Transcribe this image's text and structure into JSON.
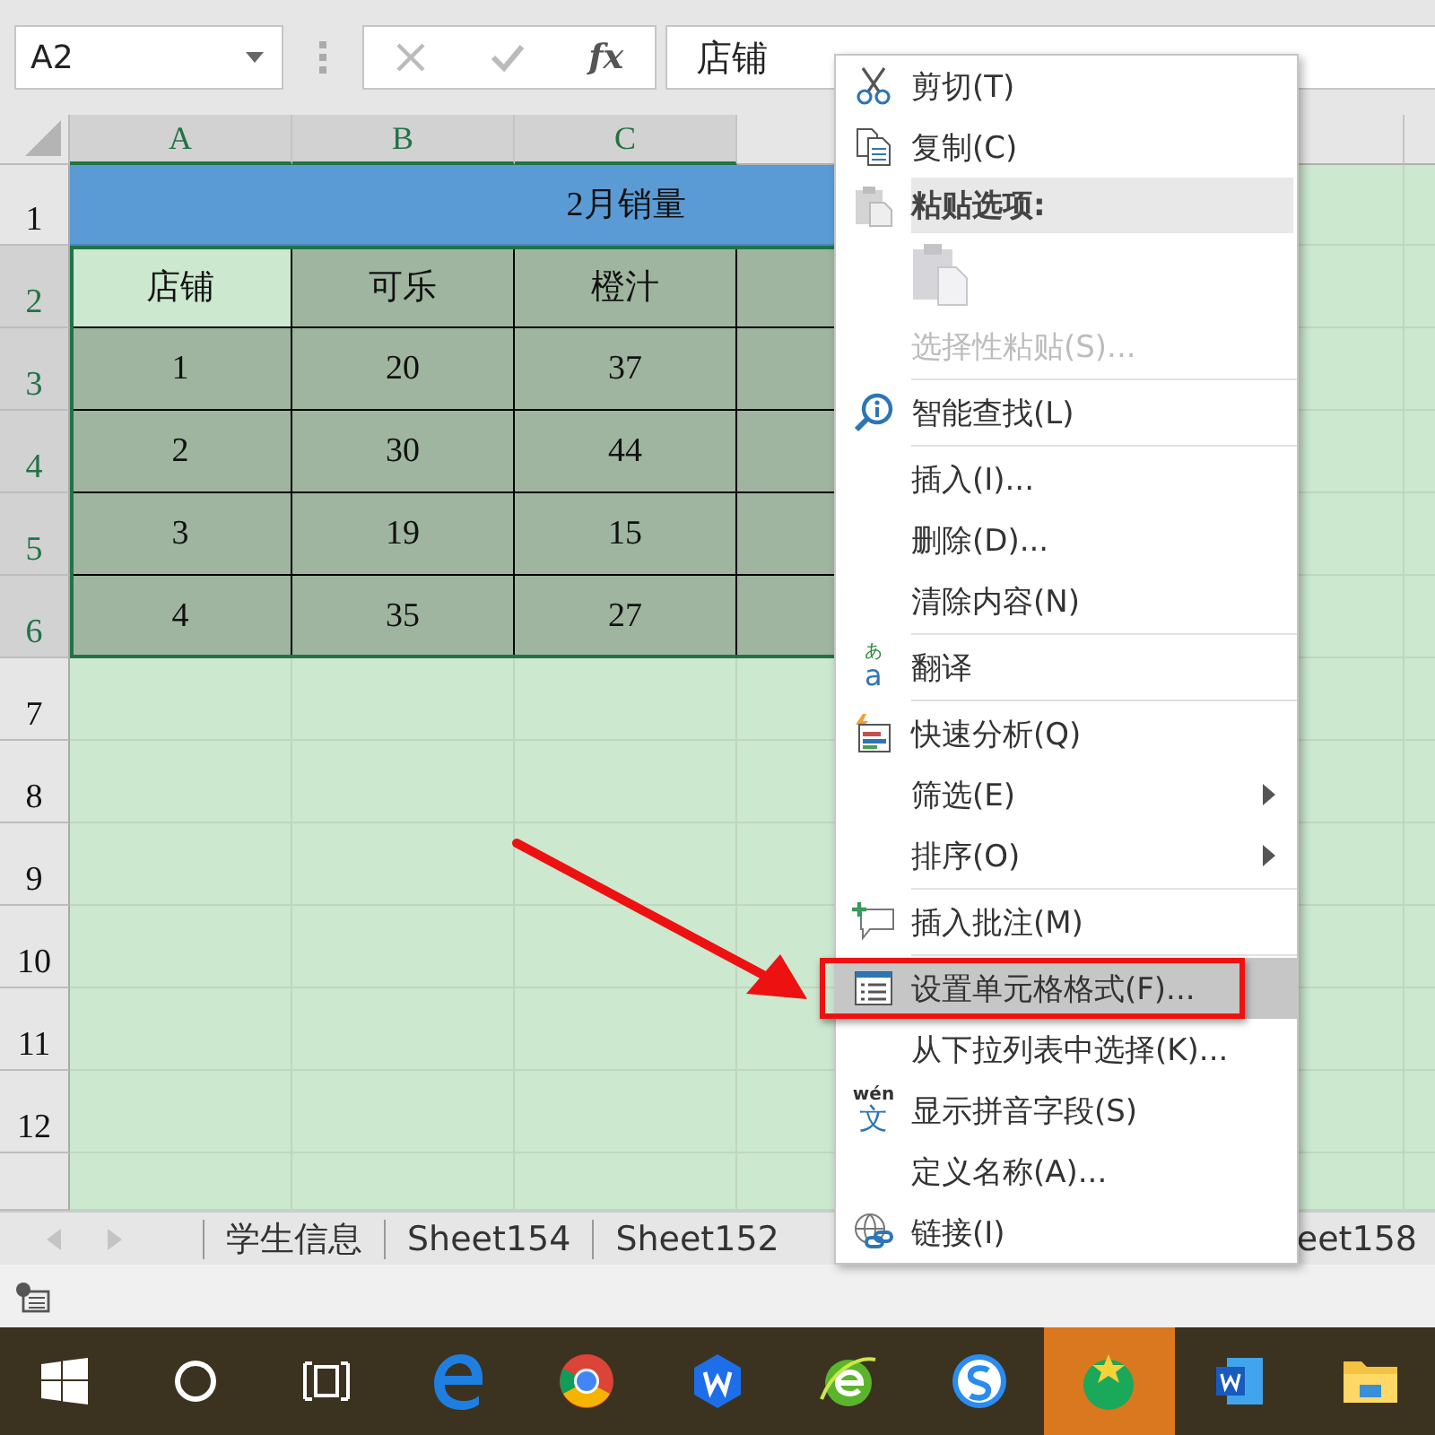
{
  "name_box": {
    "value": "A2"
  },
  "formula_bar": {
    "function_label": "fx",
    "value": "店铺"
  },
  "sheet": {
    "columns": [
      {
        "label": "A",
        "selected": true
      },
      {
        "label": "B",
        "selected": true
      },
      {
        "label": "C",
        "selected": true
      }
    ],
    "rows": [
      {
        "label": "1",
        "selected": false,
        "kind": "title",
        "text": "2月销量"
      },
      {
        "label": "2",
        "selected": true,
        "kind": "table",
        "cells": [
          {
            "text": "店铺",
            "active": true
          },
          {
            "text": "可乐",
            "active": false
          },
          {
            "text": "橙汁",
            "active": false
          }
        ]
      },
      {
        "label": "3",
        "selected": true,
        "kind": "table",
        "cells": [
          {
            "text": "1",
            "active": false
          },
          {
            "text": "20",
            "active": false
          },
          {
            "text": "37",
            "active": false
          }
        ]
      },
      {
        "label": "4",
        "selected": true,
        "kind": "table",
        "cells": [
          {
            "text": "2",
            "active": false
          },
          {
            "text": "30",
            "active": false
          },
          {
            "text": "44",
            "active": false
          }
        ]
      },
      {
        "label": "5",
        "selected": true,
        "kind": "table",
        "cells": [
          {
            "text": "3",
            "active": false
          },
          {
            "text": "19",
            "active": false
          },
          {
            "text": "15",
            "active": false
          }
        ]
      },
      {
        "label": "6",
        "selected": true,
        "kind": "table",
        "cells": [
          {
            "text": "4",
            "active": false
          },
          {
            "text": "35",
            "active": false
          },
          {
            "text": "27",
            "active": false
          }
        ]
      },
      {
        "label": "7",
        "selected": false,
        "kind": "blank"
      },
      {
        "label": "8",
        "selected": false,
        "kind": "blank"
      },
      {
        "label": "9",
        "selected": false,
        "kind": "blank"
      },
      {
        "label": "10",
        "selected": false,
        "kind": "blank"
      },
      {
        "label": "11",
        "selected": false,
        "kind": "blank"
      },
      {
        "label": "12",
        "selected": false,
        "kind": "blank"
      }
    ]
  },
  "sheet_tabs": [
    {
      "label": "学生信息",
      "selected": false
    },
    {
      "label": "Sheet154",
      "selected": false
    },
    {
      "label": "Sheet152",
      "selected": false
    },
    {
      "label": "eet158",
      "selected": false
    }
  ],
  "context_menu": [
    {
      "kind": "cut",
      "label": "剪切(T)",
      "disabled": false,
      "highlighted": false,
      "submenu": false,
      "separator_after": false,
      "callout": false
    },
    {
      "kind": "copy",
      "label": "复制(C)",
      "disabled": false,
      "highlighted": false,
      "submenu": false,
      "separator_after": false,
      "callout": false
    },
    {
      "kind": "paste_header",
      "label": "粘贴选项:",
      "disabled": false,
      "highlighted": false,
      "submenu": false,
      "separator_after": false,
      "callout": false
    },
    {
      "kind": "paste_button",
      "disabled": false,
      "highlighted": false,
      "submenu": false,
      "separator_after": false,
      "callout": false
    },
    {
      "kind": "plain",
      "label": "选择性粘贴(S)...",
      "disabled": true,
      "highlighted": false,
      "submenu": false,
      "separator_after": true,
      "callout": false
    },
    {
      "kind": "lookup",
      "label": "智能查找(L)",
      "disabled": false,
      "highlighted": false,
      "submenu": false,
      "separator_after": true,
      "callout": false
    },
    {
      "kind": "plain",
      "label": "插入(I)...",
      "disabled": false,
      "highlighted": false,
      "submenu": false,
      "separator_after": false,
      "callout": false
    },
    {
      "kind": "plain",
      "label": "删除(D)...",
      "disabled": false,
      "highlighted": false,
      "submenu": false,
      "separator_after": false,
      "callout": false
    },
    {
      "kind": "plain",
      "label": "清除内容(N)",
      "disabled": false,
      "highlighted": false,
      "submenu": false,
      "separator_after": true,
      "callout": false
    },
    {
      "kind": "translate",
      "label": "翻译",
      "icon_text": {
        "top": "あ",
        "main": "a"
      },
      "disabled": false,
      "highlighted": false,
      "submenu": false,
      "separator_after": true,
      "callout": false
    },
    {
      "kind": "quick_analysis",
      "label": "快速分析(Q)",
      "disabled": false,
      "highlighted": false,
      "submenu": false,
      "separator_after": false,
      "callout": false
    },
    {
      "kind": "plain",
      "label": "筛选(E)",
      "disabled": false,
      "highlighted": false,
      "submenu": true,
      "separator_after": false,
      "callout": false
    },
    {
      "kind": "plain",
      "label": "排序(O)",
      "disabled": false,
      "highlighted": false,
      "submenu": true,
      "separator_after": true,
      "callout": false
    },
    {
      "kind": "comment",
      "label": "插入批注(M)",
      "disabled": false,
      "highlighted": false,
      "submenu": false,
      "separator_after": true,
      "callout": false
    },
    {
      "kind": "format",
      "label": "设置单元格格式(F)...",
      "disabled": false,
      "highlighted": true,
      "submenu": false,
      "separator_after": false,
      "callout": true
    },
    {
      "kind": "plain",
      "label": "从下拉列表中选择(K)...",
      "disabled": false,
      "highlighted": false,
      "submenu": false,
      "separator_after": false,
      "callout": false
    },
    {
      "kind": "phonetic",
      "label": "显示拼音字段(S)",
      "icon_text": {
        "top": "wén",
        "main": "文"
      },
      "disabled": false,
      "highlighted": false,
      "submenu": false,
      "separator_after": false,
      "callout": false
    },
    {
      "kind": "plain",
      "label": "定义名称(A)...",
      "disabled": false,
      "highlighted": false,
      "submenu": false,
      "separator_after": false,
      "callout": false
    },
    {
      "kind": "link",
      "label": "链接(I)",
      "disabled": false,
      "highlighted": false,
      "submenu": false,
      "separator_after": false,
      "callout": false
    }
  ],
  "annotations": [
    {
      "kind": "arrow"
    }
  ],
  "taskbar": [
    {
      "kind": "start",
      "active": false
    },
    {
      "kind": "ring",
      "active": false
    },
    {
      "kind": "taskview",
      "active": false
    },
    {
      "kind": "blue_e",
      "active": false
    },
    {
      "kind": "ball",
      "active": false
    },
    {
      "kind": "hexagon",
      "active": false
    },
    {
      "kind": "green_e",
      "active": false
    },
    {
      "kind": "blue_s",
      "active": false
    },
    {
      "kind": "green_star",
      "active": true
    },
    {
      "kind": "doc",
      "active": false
    },
    {
      "kind": "folder",
      "active": false
    }
  ]
}
